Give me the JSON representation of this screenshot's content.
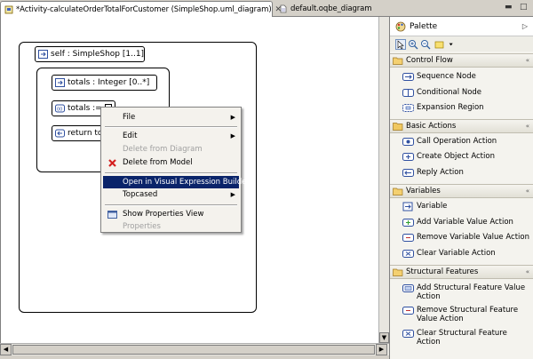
{
  "tabs": {
    "active": {
      "label": "*Activity-calculateOrderTotalForCustomer (SimpleShop.uml_diagram)",
      "close": "✕"
    },
    "inactive": {
      "label": "default.oqbe_diagram"
    }
  },
  "window_controls": {
    "minimize": "▬",
    "maximize": "□"
  },
  "diagram": {
    "self_pin": "self : SimpleShop [1..1]",
    "totals_pin": "totals : Integer [0..*]",
    "totals_assign": "totals :=",
    "return_pin": "return  tot"
  },
  "context_menu": {
    "items": [
      {
        "label": "File",
        "submenu": true,
        "disabled": false
      },
      {
        "label": "Edit",
        "submenu": true,
        "disabled": false
      },
      {
        "label": "Delete from Diagram",
        "submenu": false,
        "disabled": true
      },
      {
        "label": "Delete from Model",
        "submenu": false,
        "disabled": false,
        "icon": "red-x-icon"
      },
      {
        "label": "Open in Visual Expression Builder",
        "submenu": false,
        "disabled": false,
        "selected": true
      },
      {
        "label": "Topcased",
        "submenu": true,
        "disabled": false
      },
      {
        "label": "Show Properties View",
        "submenu": false,
        "disabled": false,
        "icon": "properties-icon"
      },
      {
        "label": "Properties",
        "submenu": false,
        "disabled": true
      }
    ],
    "submenu_arrow": "▶"
  },
  "palette": {
    "title": "Palette",
    "collapse_glyph": "▷",
    "drawers": [
      {
        "label": "Control Flow",
        "tools": [
          "Sequence Node",
          "Conditional Node",
          "Expansion Region"
        ]
      },
      {
        "label": "Basic Actions",
        "tools": [
          "Call Operation Action",
          "Create Object Action",
          "Reply Action"
        ]
      },
      {
        "label": "Variables",
        "tools": [
          "Variable",
          "Add Variable Value Action",
          "Remove Variable Value Action",
          "Clear Variable Action"
        ]
      },
      {
        "label": "Structural Features",
        "tools": [
          "Add Structural Feature Value Action",
          "Remove Structural Feature Value Action",
          "Clear Structural Feature Action"
        ]
      }
    ],
    "drawer_chevron": "«"
  },
  "scroll": {
    "up": "▲",
    "down": "▼",
    "left": "◀",
    "right": "▶"
  },
  "colors": {
    "selection": "#0a246a",
    "panel": "#d4d0c8",
    "delete_red": "#d42020"
  }
}
